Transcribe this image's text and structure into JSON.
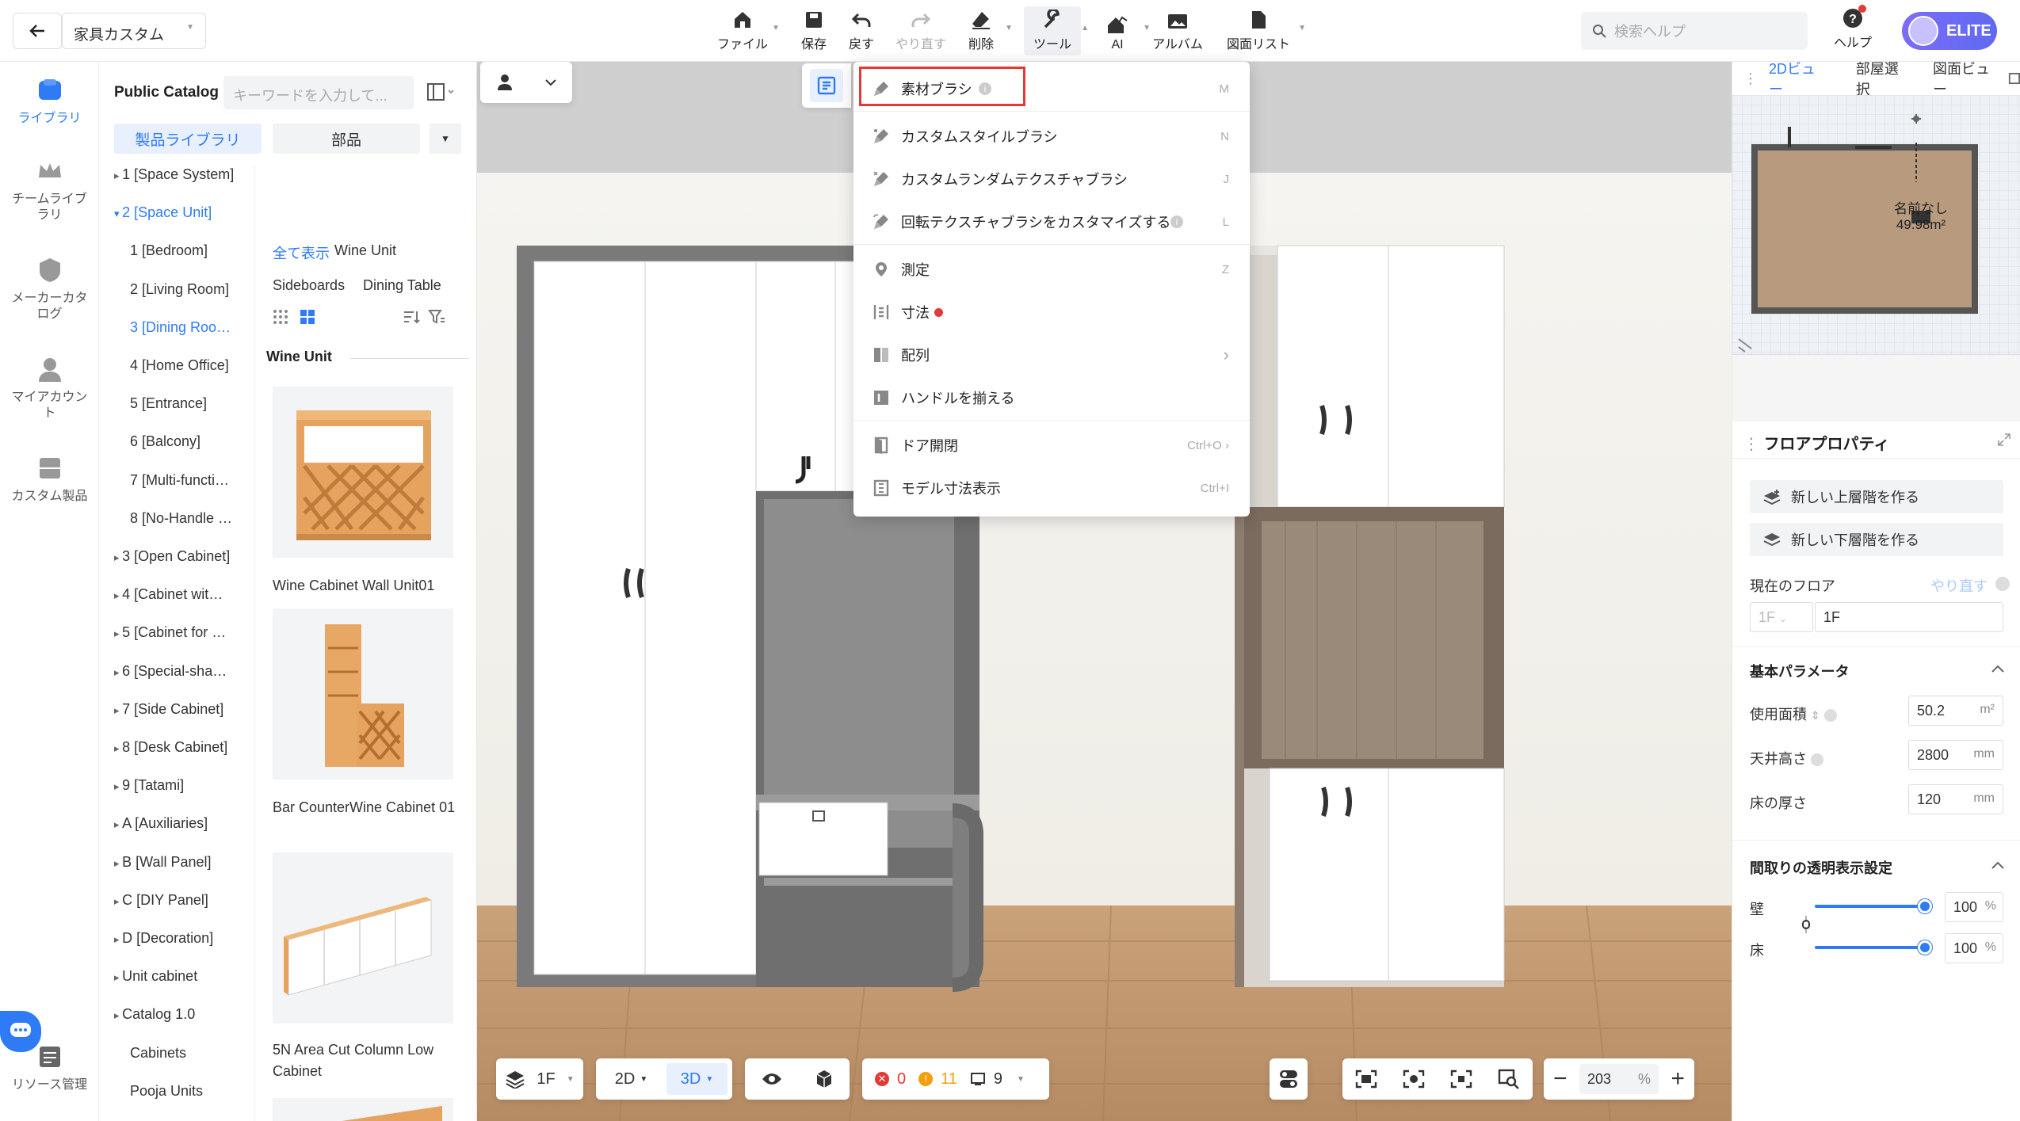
{
  "topbar": {
    "project": "家具カスタム",
    "search_placeholder": "検索ヘルプ",
    "help": "ヘルプ",
    "elite": "ELITE",
    "tools": [
      {
        "label": "ファイル"
      },
      {
        "label": "保存"
      },
      {
        "label": "戻す"
      },
      {
        "label": "やり直す"
      },
      {
        "label": "削除"
      },
      {
        "label": "ツール"
      },
      {
        "label": "AI"
      },
      {
        "label": "アルバム"
      },
      {
        "label": "図面リスト"
      }
    ]
  },
  "rail": {
    "items": [
      "ライブラリ",
      "チームライブラリ",
      "メーカーカタログ",
      "マイアカウント",
      "カスタム製品",
      "リソース管理"
    ]
  },
  "catalog": {
    "title": "Public Catalog",
    "search_placeholder": "キーワードを入力して...",
    "tab_products": "製品ライブラリ",
    "tab_parts": "部品",
    "tree": [
      "1 [Space System]",
      "2 [Space Unit]",
      "1 [Bedroom]",
      "2 [Living Room]",
      "3 [Dining Roo…",
      "4 [Home Office]",
      "5 [Entrance]",
      "6 [Balcony]",
      "7 [Multi-functi…",
      "8 [No-Handle …",
      "3 [Open Cabinet]",
      "4 [Cabinet wit…",
      "5 [Cabinet for …",
      "6 [Special-sha…",
      "7 [Side Cabinet]",
      "8 [Desk Cabinet]",
      "9 [Tatami]",
      "A [Auxiliaries]",
      "B [Wall Panel]",
      "C [DIY Panel]",
      "D [Decoration]",
      "Unit cabinet",
      "Catalog 1.0",
      "Cabinets",
      "Pooja Units"
    ],
    "filters": [
      "全て表示",
      "Wine Unit",
      "Sideboards",
      "Dining Table"
    ],
    "section": "Wine Unit",
    "products": [
      "Wine Cabinet Wall Unit01",
      "Bar CounterWine Cabinet 01",
      "5N Area Cut Column Low Cabinet"
    ]
  },
  "menu": {
    "items": [
      {
        "label": "素材ブラシ",
        "key": "M"
      },
      {
        "label": "カスタムスタイルブラシ",
        "key": "N"
      },
      {
        "label": "カスタムランダムテクスチャブラシ",
        "key": "J"
      },
      {
        "label": "回転テクスチャブラシをカスタマイズする",
        "key": "L"
      },
      {
        "label": "測定",
        "key": "Z"
      },
      {
        "label": "寸法",
        "key": ""
      },
      {
        "label": "配列",
        "key": "›"
      },
      {
        "label": "ハンドルを揃える",
        "key": ""
      },
      {
        "label": "ドア開閉",
        "key": "Ctrl+O  ›"
      },
      {
        "label": "モデル寸法表示",
        "key": "Ctrl+I"
      }
    ]
  },
  "minimap": {
    "tabs": [
      "2Dビュー",
      "部屋選択",
      "図面ビュー"
    ],
    "room_name": "名前なし",
    "area": "49.98m²"
  },
  "floorprops": {
    "title": "フロアプロパティ",
    "add_upper": "新しい上層階を作る",
    "add_lower": "新しい下層階を作る",
    "current_floor": "現在のフロア",
    "redo": "やり直す",
    "floor_a": "1F",
    "floor_b": "1F",
    "basic": "基本パラメータ",
    "area_label": "使用面積",
    "area_value": "50.2",
    "area_unit": "m²",
    "ceil_label": "天井高さ",
    "ceil_value": "2800",
    "ceil_unit": "mm",
    "floor_label": "床の厚さ",
    "floor_value": "120",
    "floor_unit": "mm",
    "transparency": "間取りの透明表示設定",
    "wall": "壁",
    "wall_value": "100",
    "floor": "床",
    "floor_value_t": "100",
    "pct": "%"
  },
  "bottombar": {
    "floor": "1F",
    "mode2d": "2D",
    "mode3d": "3D",
    "errors": "0",
    "warnings": "11",
    "items": "9",
    "zoom": "203",
    "zoom_unit": "%"
  }
}
